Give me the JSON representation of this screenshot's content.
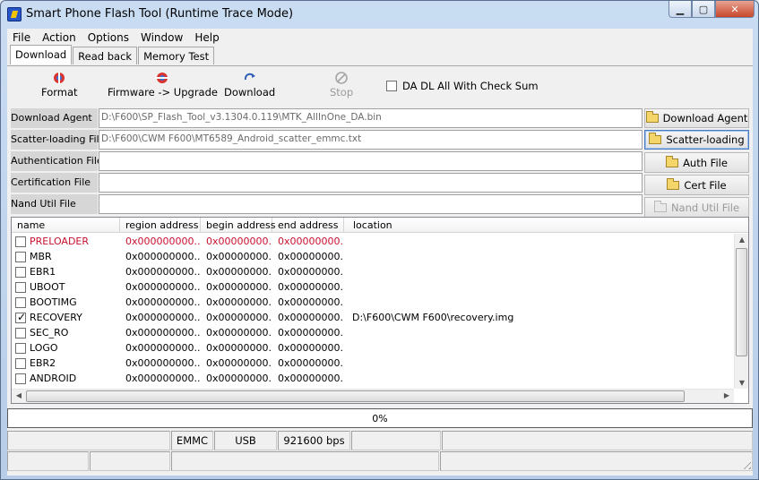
{
  "window": {
    "title": "Smart Phone Flash Tool (Runtime Trace Mode)"
  },
  "menu": [
    "File",
    "Action",
    "Options",
    "Window",
    "Help"
  ],
  "tabs": [
    "Download",
    "Read back",
    "Memory Test"
  ],
  "toolbar": {
    "format": "Format",
    "firmware_upgrade": "Firmware -> Upgrade",
    "download": "Download",
    "stop": "Stop",
    "checksum_label": "DA DL All With Check Sum"
  },
  "fields": {
    "download_agent": {
      "label": "Download Agent",
      "value": "D:\\F600\\SP_Flash_Tool_v3.1304.0.119\\MTK_AllInOne_DA.bin",
      "button": "Download Agent"
    },
    "scatter": {
      "label": "Scatter-loading File",
      "value": "D:\\F600\\CWM F600\\MT6589_Android_scatter_emmc.txt",
      "button": "Scatter-loading"
    },
    "auth": {
      "label": "Authentication File",
      "value": "",
      "button": "Auth File"
    },
    "cert": {
      "label": "Certification File",
      "value": "",
      "button": "Cert File"
    },
    "nand": {
      "label": "Nand Util File",
      "value": "",
      "button": "Nand Util File"
    }
  },
  "table": {
    "columns": [
      "name",
      "region address",
      "begin address",
      "end address",
      "location"
    ],
    "rows": [
      {
        "name": "PRELOADER",
        "region": "0x000000000...",
        "begin": "0x00000000...",
        "end": "0x00000000...",
        "location": "",
        "checked": false,
        "red": true
      },
      {
        "name": "MBR",
        "region": "0x000000000...",
        "begin": "0x00000000...",
        "end": "0x00000000...",
        "location": "",
        "checked": false,
        "red": false
      },
      {
        "name": "EBR1",
        "region": "0x000000000...",
        "begin": "0x00000000...",
        "end": "0x00000000...",
        "location": "",
        "checked": false,
        "red": false
      },
      {
        "name": "UBOOT",
        "region": "0x000000000...",
        "begin": "0x00000000...",
        "end": "0x00000000...",
        "location": "",
        "checked": false,
        "red": false
      },
      {
        "name": "BOOTIMG",
        "region": "0x000000000...",
        "begin": "0x00000000...",
        "end": "0x00000000...",
        "location": "",
        "checked": false,
        "red": false
      },
      {
        "name": "RECOVERY",
        "region": "0x000000000...",
        "begin": "0x00000000...",
        "end": "0x00000000...",
        "location": "D:\\F600\\CWM F600\\recovery.img",
        "checked": true,
        "red": false
      },
      {
        "name": "SEC_RO",
        "region": "0x000000000...",
        "begin": "0x00000000...",
        "end": "0x00000000...",
        "location": "",
        "checked": false,
        "red": false
      },
      {
        "name": "LOGO",
        "region": "0x000000000...",
        "begin": "0x00000000...",
        "end": "0x00000000...",
        "location": "",
        "checked": false,
        "red": false
      },
      {
        "name": "EBR2",
        "region": "0x000000000...",
        "begin": "0x00000000...",
        "end": "0x00000000...",
        "location": "",
        "checked": false,
        "red": false
      },
      {
        "name": "ANDROID",
        "region": "0x000000000...",
        "begin": "0x00000000...",
        "end": "0x00000000...",
        "location": "",
        "checked": false,
        "red": false
      }
    ]
  },
  "progress": {
    "value": 0,
    "text": "0%"
  },
  "status": {
    "storage": "EMMC",
    "port": "USB",
    "baud": "921600 bps"
  },
  "colors": {
    "error_row": "#c8102e",
    "disabled_text": "#9a9a9a"
  }
}
